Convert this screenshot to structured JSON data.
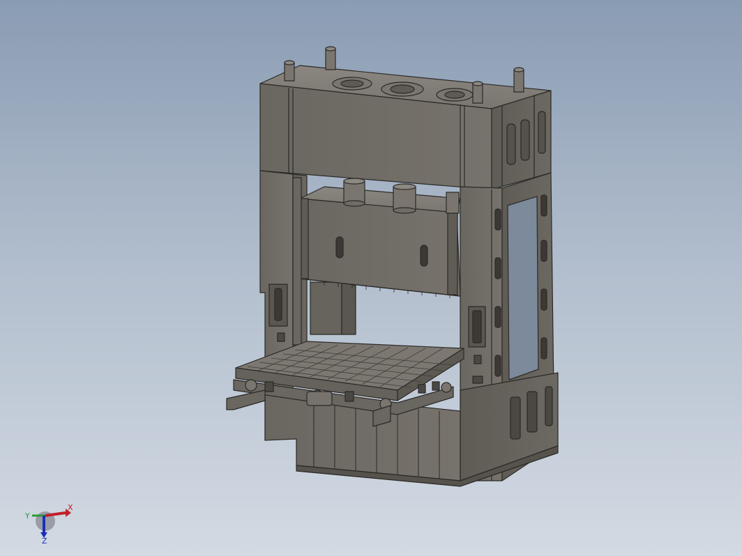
{
  "viewport": {
    "background_top": "#8a9cb3",
    "background_bottom": "#d3dae3",
    "model_color": "#6e6a64",
    "model_edge_color": "#2b2926"
  },
  "triad": {
    "x_label": "X",
    "y_label": "Y",
    "z_label": "Z",
    "x_color": "#c0202a",
    "y_color": "#2d9a3a",
    "z_color": "#1c2fb8"
  }
}
